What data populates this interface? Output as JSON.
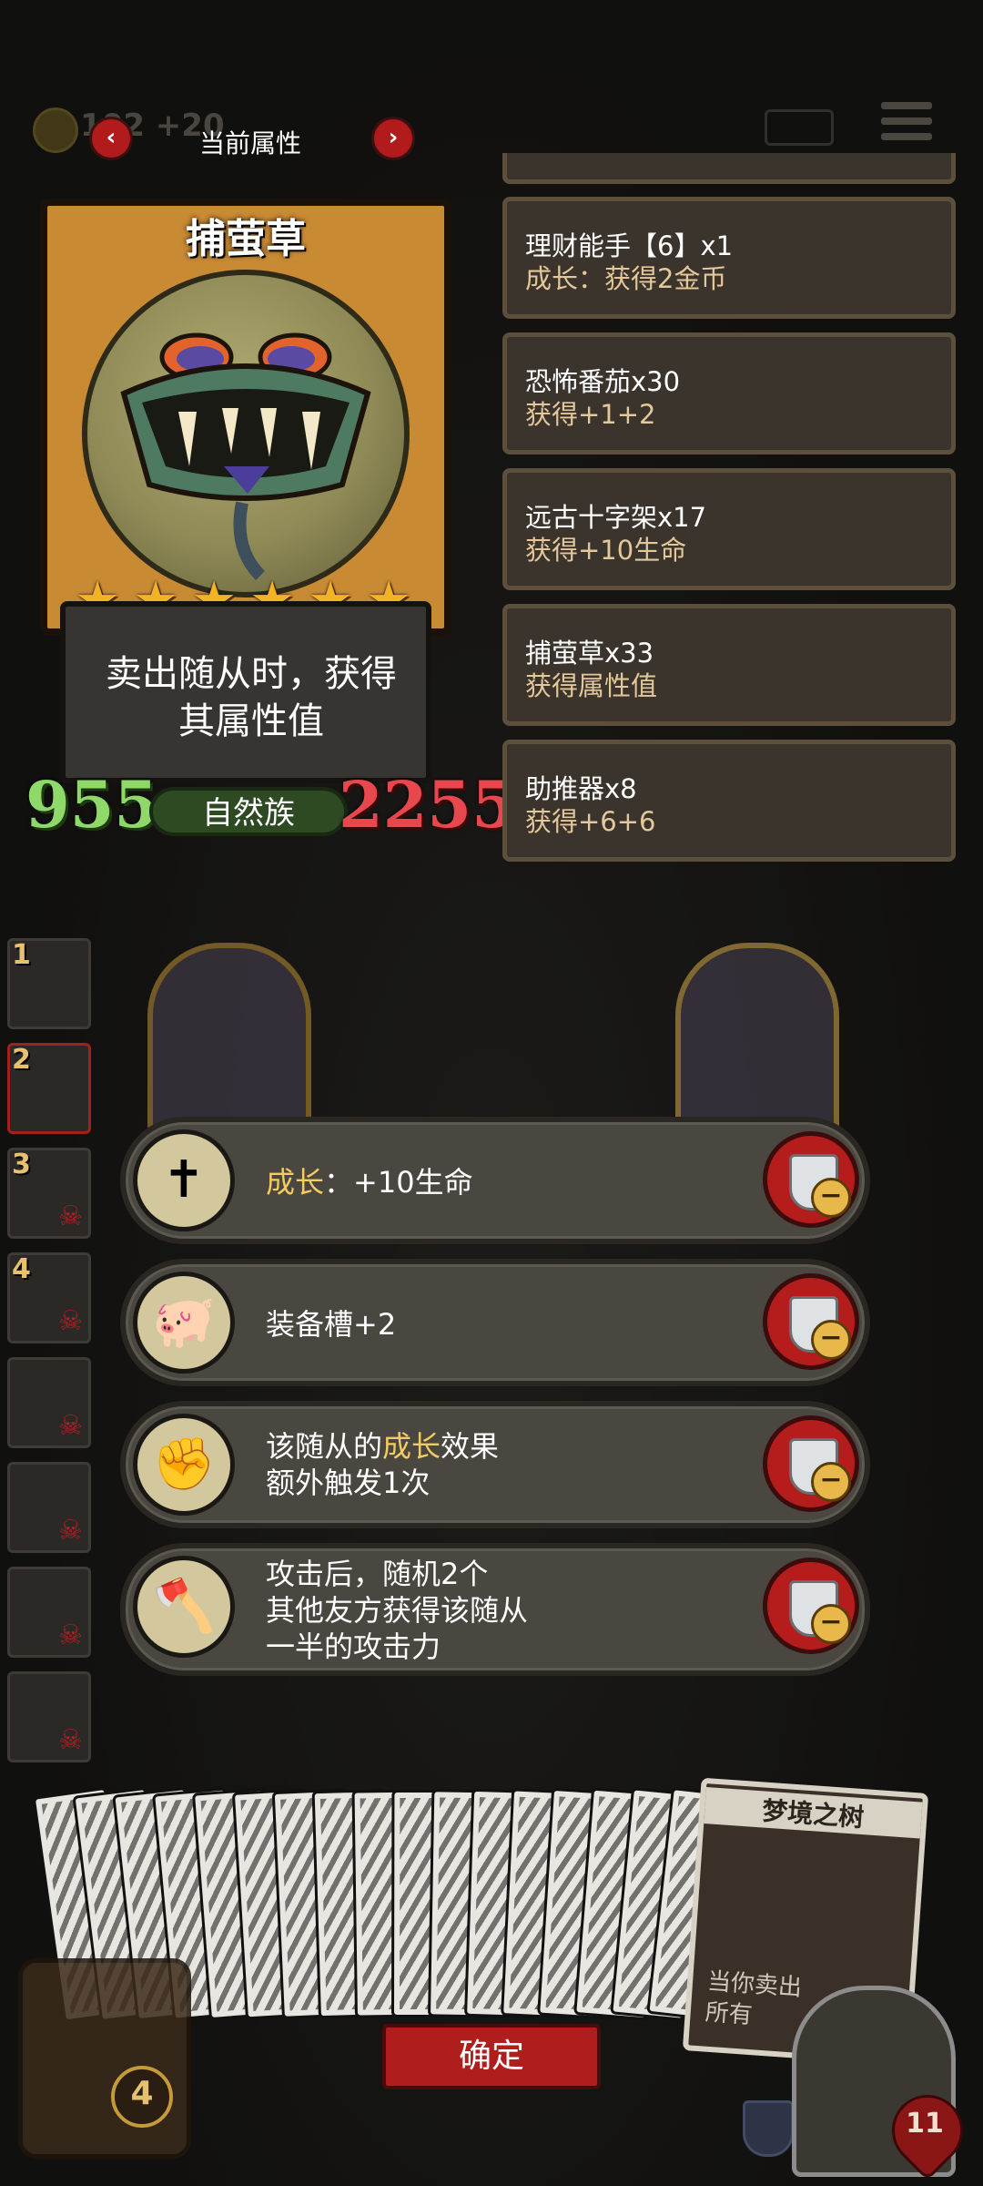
{
  "top": {
    "gold_text": "102 +20",
    "attr_title": "当前属性",
    "prev_label": "‹",
    "next_label": "›"
  },
  "card": {
    "name": "捕萤草",
    "stars": 6,
    "desc_line1": "卖出随从时，获得",
    "desc_line2": "其属性值",
    "attack": "955",
    "health": "2255",
    "tribe": "自然族"
  },
  "history": [
    {
      "name": "理财能手【6】x1",
      "effect": "成长：获得2金币"
    },
    {
      "name": "恐怖番茄x30",
      "effect": "获得+1+2"
    },
    {
      "name": "远古十字架x17",
      "effect": "获得+10生命"
    },
    {
      "name": "捕萤草x33",
      "effect": "获得属性值"
    },
    {
      "name": "助推器x8",
      "effect": "获得+6+6"
    }
  ],
  "side_slots": [
    {
      "num": "1"
    },
    {
      "num": "2"
    },
    {
      "num": "3"
    },
    {
      "num": "4"
    },
    {
      "num": ""
    },
    {
      "num": ""
    },
    {
      "num": ""
    },
    {
      "num": ""
    }
  ],
  "equipment": [
    {
      "icon": "cross-icon",
      "hl": "成长",
      "sep": "：",
      "text": "+10生命"
    },
    {
      "icon": "pig-icon",
      "text": "装备槽+2"
    },
    {
      "icon": "gauntlet-icon",
      "pre": "该随从的",
      "hl": "成长",
      "post": "效果",
      "line2": "额外触发1次"
    },
    {
      "icon": "axe-icon",
      "line1": "攻击后，随机2个",
      "line2": "其他友方获得该随从",
      "line3": "一半的攻击力"
    }
  ],
  "deck": {
    "dream_name": "梦境之树",
    "dream_sub1": "当你卖出",
    "dream_sub2": "所有"
  },
  "bottom": {
    "confirm_label": "确定",
    "bag_count": "4",
    "hero_health": "11"
  },
  "colors": {
    "accent_red": "#b01d1d",
    "attack_green": "#8fd86a",
    "health_red": "#e8474d",
    "highlight_gold": "#f2cb62"
  }
}
